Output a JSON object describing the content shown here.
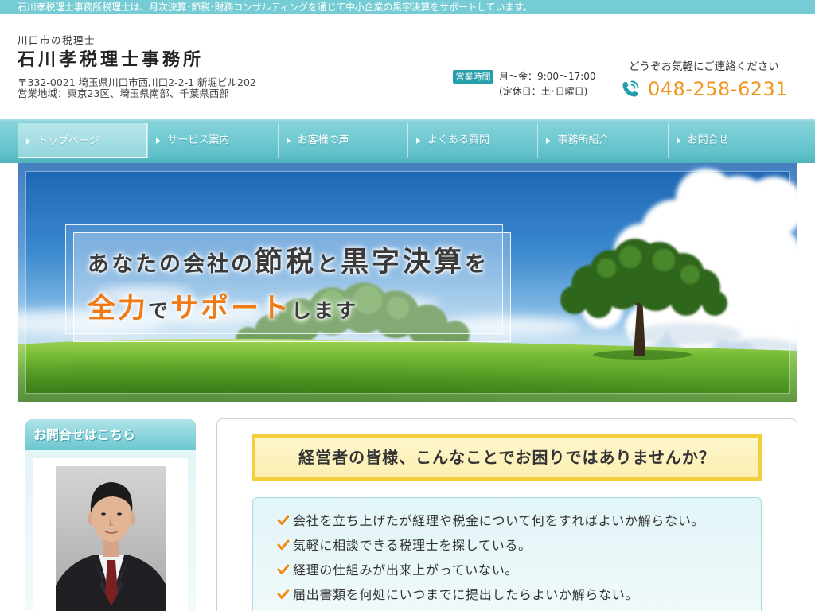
{
  "top_bar": {
    "text": "石川孝税理士事務所税理士は、月次決算･節税･財務コンサルティングを通じて中小企業の黒字決算をサポートしています。"
  },
  "header": {
    "tagline": "川口市の税理士",
    "office_name": "石川孝税理士事務所",
    "address": "〒332-0021 埼玉県川口市西川口2-2-1 新堀ビル202",
    "service_area": "営業地域：東京23区、埼玉県南部、千葉県西部",
    "hours_badge": "営業時間",
    "hours": "月～金：9:00～17:00",
    "closed_days": "(定休日：土･日曜日)",
    "contact_prompt": "どうぞお気軽にご連絡ください",
    "phone_number": "048-258-6231",
    "phone_icon": "phone-icon"
  },
  "nav": {
    "arrow_icon": "triangle-right-icon",
    "active_index": 0,
    "items": [
      {
        "label": "トップページ"
      },
      {
        "label": "サービス案内"
      },
      {
        "label": "お客様の声"
      },
      {
        "label": "よくある質問"
      },
      {
        "label": "事務所紹介"
      },
      {
        "label": "お問合せ"
      }
    ]
  },
  "hero": {
    "line1": {
      "a": "あなたの会社の",
      "b": "節税",
      "c": "と",
      "d": "黒字決算",
      "e": "を"
    },
    "line2": {
      "a": "全力",
      "b": "で",
      "c": "サポート",
      "d": "します"
    }
  },
  "sidebar": {
    "contact_heading": "お問合せはこちら"
  },
  "main": {
    "problem_heading": "経営者の皆様、こんなことでお困りではありませんか？",
    "check_icon": "checkmark-icon",
    "checklist": [
      "会社を立ち上げたが経理や税金について何をすればよいか解らない。",
      "気軽に相談できる税理士を探している。",
      "経理の仕組みが出来上がっていない。",
      "届出書類を何処にいつまでに提出したらよいか解らない。"
    ]
  },
  "colors": {
    "accent_teal": "#6fc9d1",
    "badge_teal": "#249fa9",
    "phone_orange": "#f0961e",
    "hero_highlight_orange": "#f07b14",
    "heading_yellow": "#f3d03b"
  }
}
